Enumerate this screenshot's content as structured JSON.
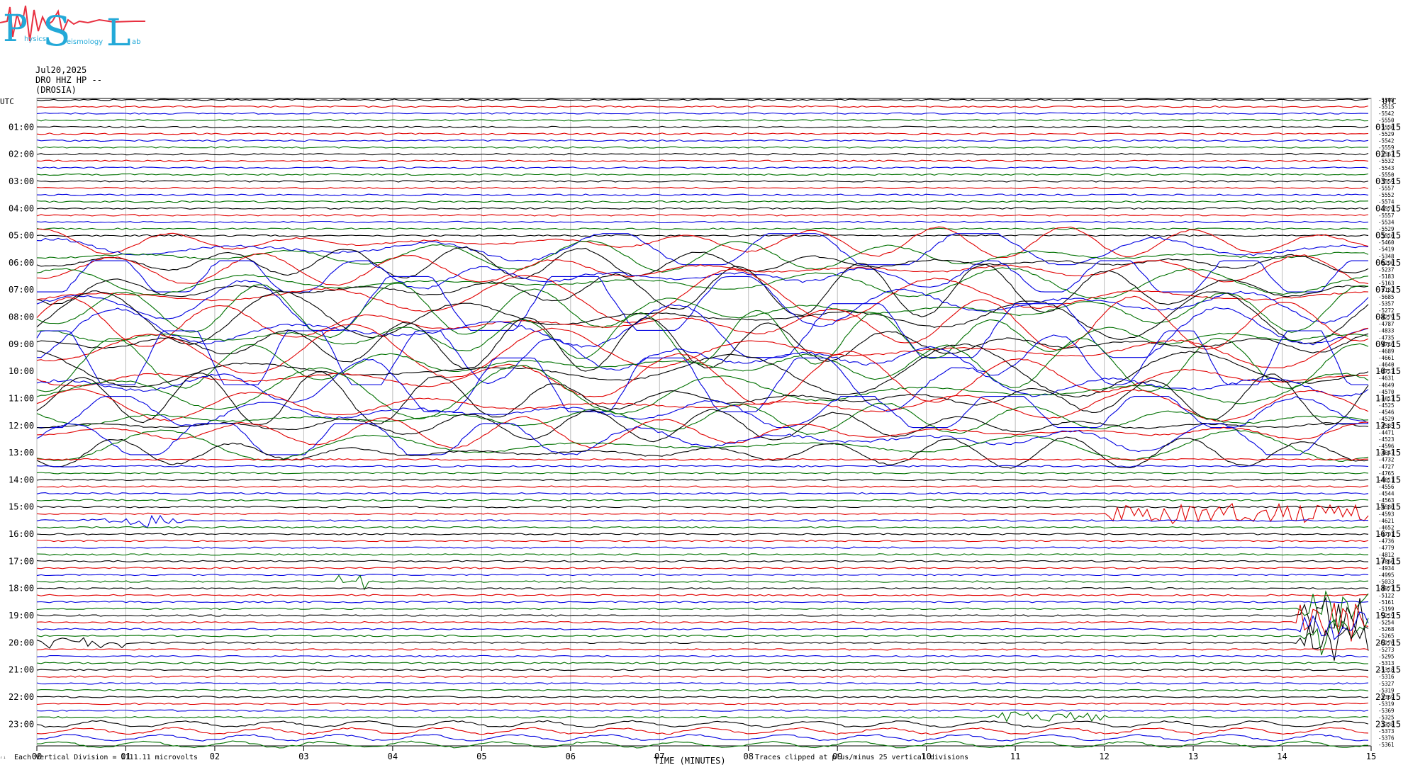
{
  "logo": {
    "letters": [
      "P",
      "S",
      "L"
    ],
    "words": [
      "hysics",
      "eismology",
      "ab"
    ]
  },
  "header": {
    "date": "Jul20,2025",
    "station": "DRO HHZ HP --",
    "location": "(DROSIA)"
  },
  "footer": {
    "scale_note": "Each Vertical Division = 1111.11 microvolts",
    "clip_note": "Traces clipped at plus/minus 25 vertical divisions",
    "tiny_mark": "ᵣᵢ"
  },
  "chart_data": {
    "type": "line",
    "xlabel": "TIME (MINUTES)",
    "left_axis_title": "UTC",
    "right_axis_title": "UTC",
    "x_ticks": [
      "00",
      "01",
      "02",
      "03",
      "04",
      "05",
      "06",
      "07",
      "08",
      "09",
      "10",
      "11",
      "12",
      "13",
      "14",
      "15"
    ],
    "xlim": [
      0,
      15
    ],
    "grid": true,
    "trace_colors": [
      "#000000",
      "#e00000",
      "#0000e0",
      "#007000"
    ],
    "left_hour_labels": [
      "01:00",
      "02:00",
      "03:00",
      "04:00",
      "05:00",
      "06:00",
      "07:00",
      "08:00",
      "09:00",
      "10:00",
      "11:00",
      "12:00",
      "13:00",
      "14:00",
      "15:00",
      "16:00",
      "17:00",
      "18:00",
      "19:00",
      "20:00",
      "21:00",
      "22:00",
      "23:00"
    ],
    "right_hour_labels": [
      "01:15",
      "02:15",
      "03:15",
      "04:15",
      "05:15",
      "06:15",
      "07:15",
      "08:15",
      "09:15",
      "10:15",
      "11:15",
      "12:15",
      "13:15",
      "14:15",
      "15:15",
      "16:15",
      "17:15",
      "18:15",
      "19:15",
      "20:15",
      "21:15",
      "22:15",
      "23:15"
    ],
    "trace_offsets": [
      "-5508",
      "-5515",
      "-5542",
      "-5550",
      "-5536",
      "-5529",
      "-5542",
      "-5559",
      "-5567",
      "-5532",
      "-5543",
      "-5550",
      "-5559",
      "-5557",
      "-5552",
      "-5574",
      "-5579",
      "-5557",
      "-5534",
      "-5529",
      "-5516",
      "-5460",
      "-5419",
      "-5348",
      "-5290",
      "-5237",
      "-5183",
      "-5163",
      "-5182",
      "-5685",
      "-5357",
      "-5272",
      "-4279",
      "-4787",
      "-4833",
      "-4735",
      "-4746",
      "-4689",
      "-4661",
      "-4640",
      "-4717",
      "-4631",
      "-4649",
      "-4570",
      "-4617",
      "-4525",
      "-4546",
      "-4529",
      "-4585",
      "-4471",
      "-4523",
      "-4596",
      "-4647",
      "-4732",
      "-4727",
      "-4765",
      "-4611",
      "-4556",
      "-4544",
      "-4563",
      "-4580",
      "-4593",
      "-4621",
      "-4652",
      "-4701",
      "-4736",
      "-4779",
      "-4812",
      "-4866",
      "-4934",
      "-4995",
      "-5033",
      "-4977",
      "-5122",
      "-5161",
      "-5199",
      "-5219",
      "-5254",
      "-5268",
      "-5265",
      "-5276",
      "-5273",
      "-5295",
      "-5313",
      "-5318",
      "-5316",
      "-5327",
      "-5319",
      "-5369",
      "-5319",
      "-5369",
      "-5325",
      "-5338",
      "-5373",
      "-5376",
      "-5361"
    ]
  }
}
